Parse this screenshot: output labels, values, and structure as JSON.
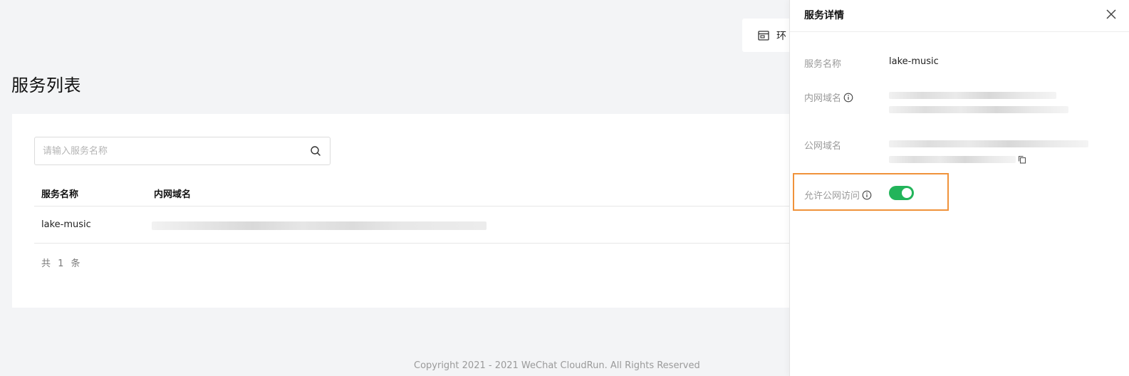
{
  "env_chip": {
    "label": "环",
    "icon": "calendar-icon"
  },
  "page": {
    "title": "服务列表"
  },
  "search": {
    "placeholder": "请输入服务名称",
    "value": "",
    "icon": "search-icon"
  },
  "table": {
    "headers": [
      "服务名称",
      "内网域名"
    ],
    "rows": [
      {
        "name": "lake-music",
        "internal_domain": ""
      }
    ],
    "count_text": "共 1 条"
  },
  "footer": {
    "text": "Copyright 2021 - 2021 WeChat CloudRun. All Rights Reserved"
  },
  "drawer": {
    "title": "服务详情",
    "close_icon": "close-icon",
    "fields": {
      "service_name_label": "服务名称",
      "service_name_value": "lake-music",
      "internal_domain_label": "内网域名",
      "public_domain_label": "公网域名",
      "public_access_label": "允许公网访问",
      "public_access_enabled": true
    }
  },
  "colors": {
    "toggle_on": "#22b45a",
    "highlight_border": "#f0923a",
    "background": "#f3f4f6"
  }
}
